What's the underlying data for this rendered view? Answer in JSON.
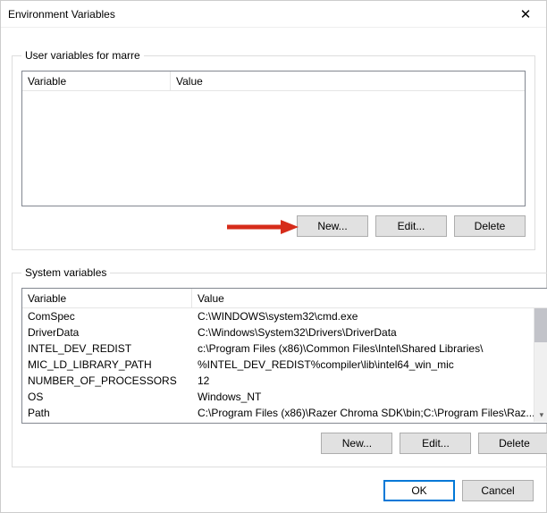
{
  "window": {
    "title": "Environment Variables",
    "close_glyph": "✕"
  },
  "user_section": {
    "legend": "User variables for marre",
    "col_variable": "Variable",
    "col_value": "Value",
    "rows": [],
    "buttons": {
      "new": "New...",
      "edit": "Edit...",
      "delete": "Delete"
    }
  },
  "system_section": {
    "legend": "System variables",
    "col_variable": "Variable",
    "col_value": "Value",
    "rows": [
      {
        "name": "ComSpec",
        "value": "C:\\WINDOWS\\system32\\cmd.exe"
      },
      {
        "name": "DriverData",
        "value": "C:\\Windows\\System32\\Drivers\\DriverData"
      },
      {
        "name": "INTEL_DEV_REDIST",
        "value": "c:\\Program Files (x86)\\Common Files\\Intel\\Shared Libraries\\"
      },
      {
        "name": "MIC_LD_LIBRARY_PATH",
        "value": "%INTEL_DEV_REDIST%compiler\\lib\\intel64_win_mic"
      },
      {
        "name": "NUMBER_OF_PROCESSORS",
        "value": "12"
      },
      {
        "name": "OS",
        "value": "Windows_NT"
      },
      {
        "name": "Path",
        "value": "C:\\Program Files (x86)\\Razer Chroma SDK\\bin;C:\\Program Files\\Raz..."
      }
    ],
    "buttons": {
      "new": "New...",
      "edit": "Edit...",
      "delete": "Delete"
    }
  },
  "footer": {
    "ok": "OK",
    "cancel": "Cancel"
  },
  "annotation": {
    "arrow_color": "#d62c1a"
  }
}
